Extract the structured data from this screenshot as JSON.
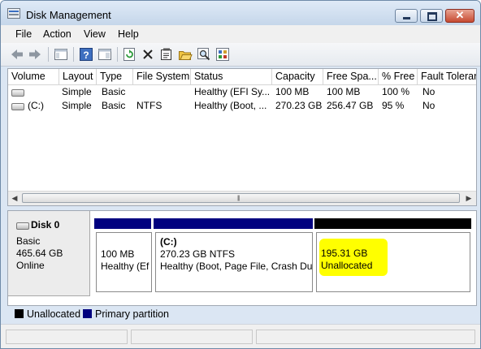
{
  "window": {
    "title": "Disk Management",
    "close_glyph": "✕"
  },
  "menu": [
    "File",
    "Action",
    "View",
    "Help"
  ],
  "toolbar": [
    "back-arrow-icon",
    "forward-arrow-icon",
    "show-hide-console-tree-icon",
    "help-icon",
    "show-hide-action-pane-icon",
    "refresh-icon",
    "delete-icon",
    "properties-icon",
    "open-folder-icon",
    "search-icon",
    "export-list-icon"
  ],
  "volume_list": {
    "columns": [
      "Volume",
      "Layout",
      "Type",
      "File System",
      "Status",
      "Capacity",
      "Free Spa...",
      "% Free",
      "Fault Tolerar"
    ],
    "rows": [
      [
        "",
        "Simple",
        "Basic",
        "",
        "Healthy (EFI Sy...",
        "100 MB",
        "100 MB",
        "100 %",
        "No"
      ],
      [
        "(C:)",
        "Simple",
        "Basic",
        "NTFS",
        "Healthy (Boot, ...",
        "270.23 GB",
        "256.47 GB",
        "95 %",
        "No"
      ]
    ]
  },
  "disk": {
    "name": "Disk 0",
    "type": "Basic",
    "size": "465.64 GB",
    "status": "Online",
    "partitions": [
      {
        "line1": "",
        "line2": "100 MB",
        "line3": "Healthy (Ef",
        "kind": "primary"
      },
      {
        "line1": "(C:)",
        "line2": "270.23 GB NTFS",
        "line3": "Healthy (Boot, Page File, Crash Dun",
        "kind": "primary"
      },
      {
        "line1": "195.31 GB",
        "line2": "Unallocated",
        "kind": "unallocated"
      }
    ]
  },
  "legend": [
    {
      "label": "Unallocated",
      "color": "#000000"
    },
    {
      "label": "Primary partition",
      "color": "#00007f"
    }
  ],
  "colors": {
    "primary": "#00007f",
    "unallocated": "#000000",
    "highlight": "#ffff00",
    "title_bar": "#dbe6f3"
  }
}
